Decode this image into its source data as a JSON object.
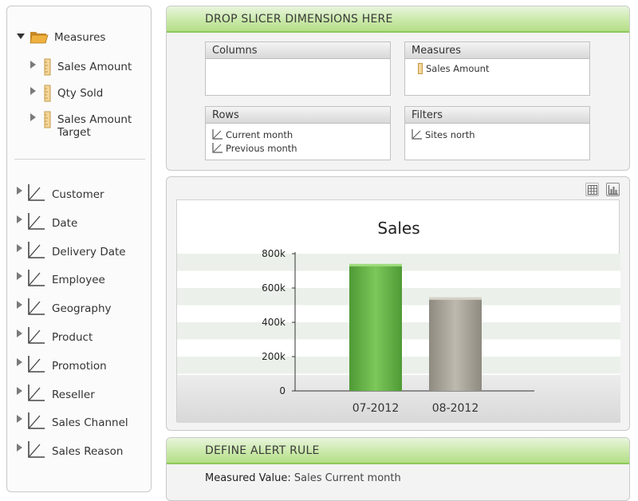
{
  "measures_tree": {
    "root_label": "Measures",
    "items": [
      {
        "label": "Sales Amount"
      },
      {
        "label": "Qty Sold"
      },
      {
        "label": "Sales Amount Target"
      }
    ]
  },
  "dimensions_tree": {
    "items": [
      {
        "label": "Customer"
      },
      {
        "label": "Date"
      },
      {
        "label": "Delivery Date"
      },
      {
        "label": "Employee"
      },
      {
        "label": "Geography"
      },
      {
        "label": "Product"
      },
      {
        "label": "Promotion"
      },
      {
        "label": "Reseller"
      },
      {
        "label": "Sales Channel"
      },
      {
        "label": "Sales Reason"
      }
    ]
  },
  "slicer_panel": {
    "header": "DROP SLICER DIMENSIONS HERE",
    "columns": {
      "title": "Columns",
      "items": []
    },
    "measures": {
      "title": "Measures",
      "items": [
        "Sales Amount"
      ]
    },
    "rows": {
      "title": "Rows",
      "items": [
        "Current month",
        "Previous month"
      ]
    },
    "filters": {
      "title": "Filters",
      "items": [
        "Sites north"
      ]
    }
  },
  "chart_toolbar": {
    "grid_view_icon": "table-grid-icon",
    "chart_view_icon": "bar-chart-icon"
  },
  "chart_data": {
    "type": "bar",
    "title": "Sales",
    "ylabel": "$",
    "xlabel": "",
    "categories": [
      "07-2012",
      "08-2012"
    ],
    "values": [
      740000,
      545000
    ],
    "ylim": [
      0,
      800000
    ],
    "y_ticks": [
      0,
      200000,
      400000,
      600000,
      800000
    ],
    "y_tick_labels": [
      "0",
      "200k",
      "400k",
      "600k",
      "800k"
    ],
    "bar_colors": [
      "#6ab547",
      "#a9a59b"
    ],
    "grid": true
  },
  "alert_panel": {
    "header": "DEFINE ALERT RULE",
    "measured_value_label": "Measured Value:",
    "measured_value": "Sales Current month"
  }
}
